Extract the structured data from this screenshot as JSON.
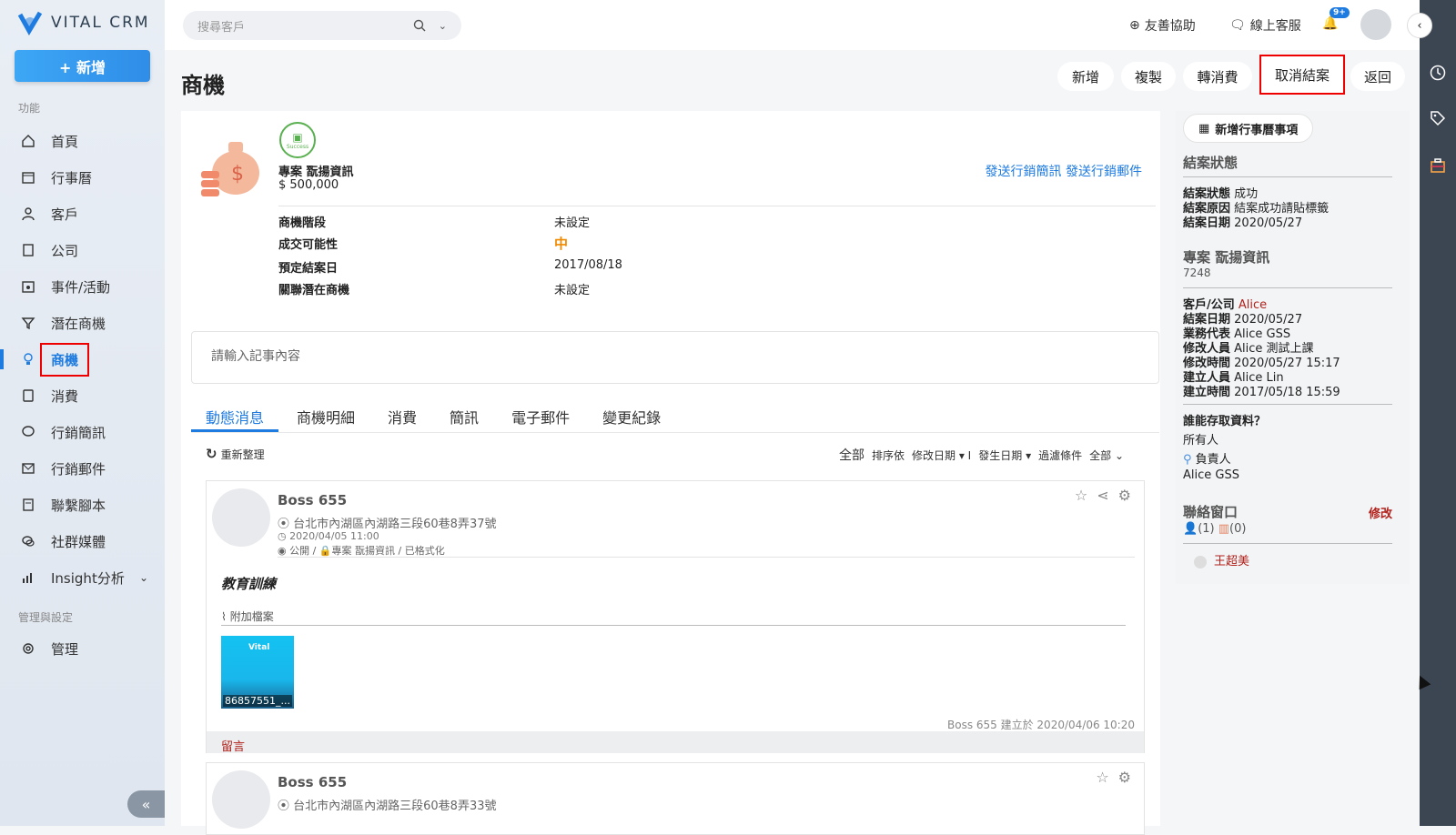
{
  "app": {
    "logo_text": "VITAL CRM",
    "new_button": "+ 新增"
  },
  "sidebar": {
    "section_function": "功能",
    "section_admin": "管理與設定",
    "items": [
      {
        "label": "首頁",
        "icon": "home-icon"
      },
      {
        "label": "行事曆",
        "icon": "calendar-icon"
      },
      {
        "label": "客戶",
        "icon": "person-icon"
      },
      {
        "label": "公司",
        "icon": "building-icon"
      },
      {
        "label": "事件/活動",
        "icon": "event-icon"
      },
      {
        "label": "潛在商機",
        "icon": "lead-icon"
      },
      {
        "label": "商機",
        "icon": "lightbulb-icon",
        "active": true
      },
      {
        "label": "消費",
        "icon": "receipt-icon"
      },
      {
        "label": "行銷簡訊",
        "icon": "sms-icon"
      },
      {
        "label": "行銷郵件",
        "icon": "mail-icon"
      },
      {
        "label": "聯繫腳本",
        "icon": "script-icon"
      },
      {
        "label": "社群媒體",
        "icon": "social-icon"
      },
      {
        "label": "Insight分析",
        "icon": "chart-icon"
      }
    ],
    "admin_item": {
      "label": "管理",
      "icon": "gear-icon"
    }
  },
  "topbar": {
    "search_placeholder": "搜尋客戶",
    "accessibility": "友善協助",
    "support": "線上客服",
    "notif_badge": "9+"
  },
  "page": {
    "title": "商機",
    "actions": [
      "新增",
      "複製",
      "轉消費",
      "取消結案",
      "返回"
    ]
  },
  "opportunity": {
    "badge_text": "Success",
    "name": "專案 翫揚資訊",
    "amount": "$ 500,000",
    "send_sms": "發送行銷簡訊",
    "send_mail": "發送行銷郵件",
    "fields": [
      {
        "label": "商機階段",
        "value": "未設定"
      },
      {
        "label": "成交可能性",
        "value": "中"
      },
      {
        "label": "預定結案日",
        "value": "2017/08/18"
      },
      {
        "label": "關聯潛在商機",
        "value": "未設定"
      }
    ],
    "note_placeholder": "請輸入記事內容"
  },
  "tabs": [
    "動態消息",
    "商機明細",
    "消費",
    "簡訊",
    "電子郵件",
    "變更紀錄"
  ],
  "feed": {
    "refresh": "重新整理",
    "all": "全部",
    "sort_by": "排序依",
    "sort_field": "修改日期",
    "date_field": "發生日期",
    "filter": "過濾條件",
    "filter_value": "全部"
  },
  "posts": [
    {
      "author": "Boss 655",
      "address": "台北市內湖區內湖路三段60巷8弄37號",
      "datetime": "2020/04/05 11:00",
      "visibility": "公開 / 🔒專案 翫揚資訊 / 已格式化",
      "title": "教育訓練",
      "attachment_label": "附加檔案",
      "thumb_logo": "Vital",
      "thumb_name": "86857551_...",
      "created": "Boss 655 建立於 2020/04/06 10:20",
      "comment": "留言"
    },
    {
      "author": "Boss 655",
      "address": "台北市內湖區內湖路三段60巷8弄33號"
    }
  ],
  "right_panel": {
    "add_calendar": "新增行事曆事項",
    "close_status_title": "結案狀態",
    "close_status": [
      {
        "label": "結案狀態",
        "value": "成功"
      },
      {
        "label": "結案原因",
        "value": "結案成功請貼標籤"
      },
      {
        "label": "結案日期",
        "value": "2020/05/27"
      }
    ],
    "project_title": "專案 翫揚資訊",
    "project_id": "7248",
    "details": [
      {
        "label": "客戶/公司",
        "value": "Alice"
      },
      {
        "label": "結案日期",
        "value": "2020/05/27"
      },
      {
        "label": "業務代表",
        "value": "Alice GSS"
      },
      {
        "label": "修改人員",
        "value": "Alice 測試上課"
      },
      {
        "label": "修改時間",
        "value": "2020/05/27 15:17"
      },
      {
        "label": "建立人員",
        "value": "Alice Lin"
      },
      {
        "label": "建立時間",
        "value": "2017/05/18 15:59"
      }
    ],
    "access_title": "誰能存取資料？",
    "access_owner": "所有人",
    "access_responsible": "負責人",
    "access_person": "Alice GSS",
    "contact_title": "聯絡窗口",
    "contact_edit": "修改",
    "contact_count1": "(1)",
    "contact_count2": "(0)",
    "contact_name": "王超美"
  }
}
